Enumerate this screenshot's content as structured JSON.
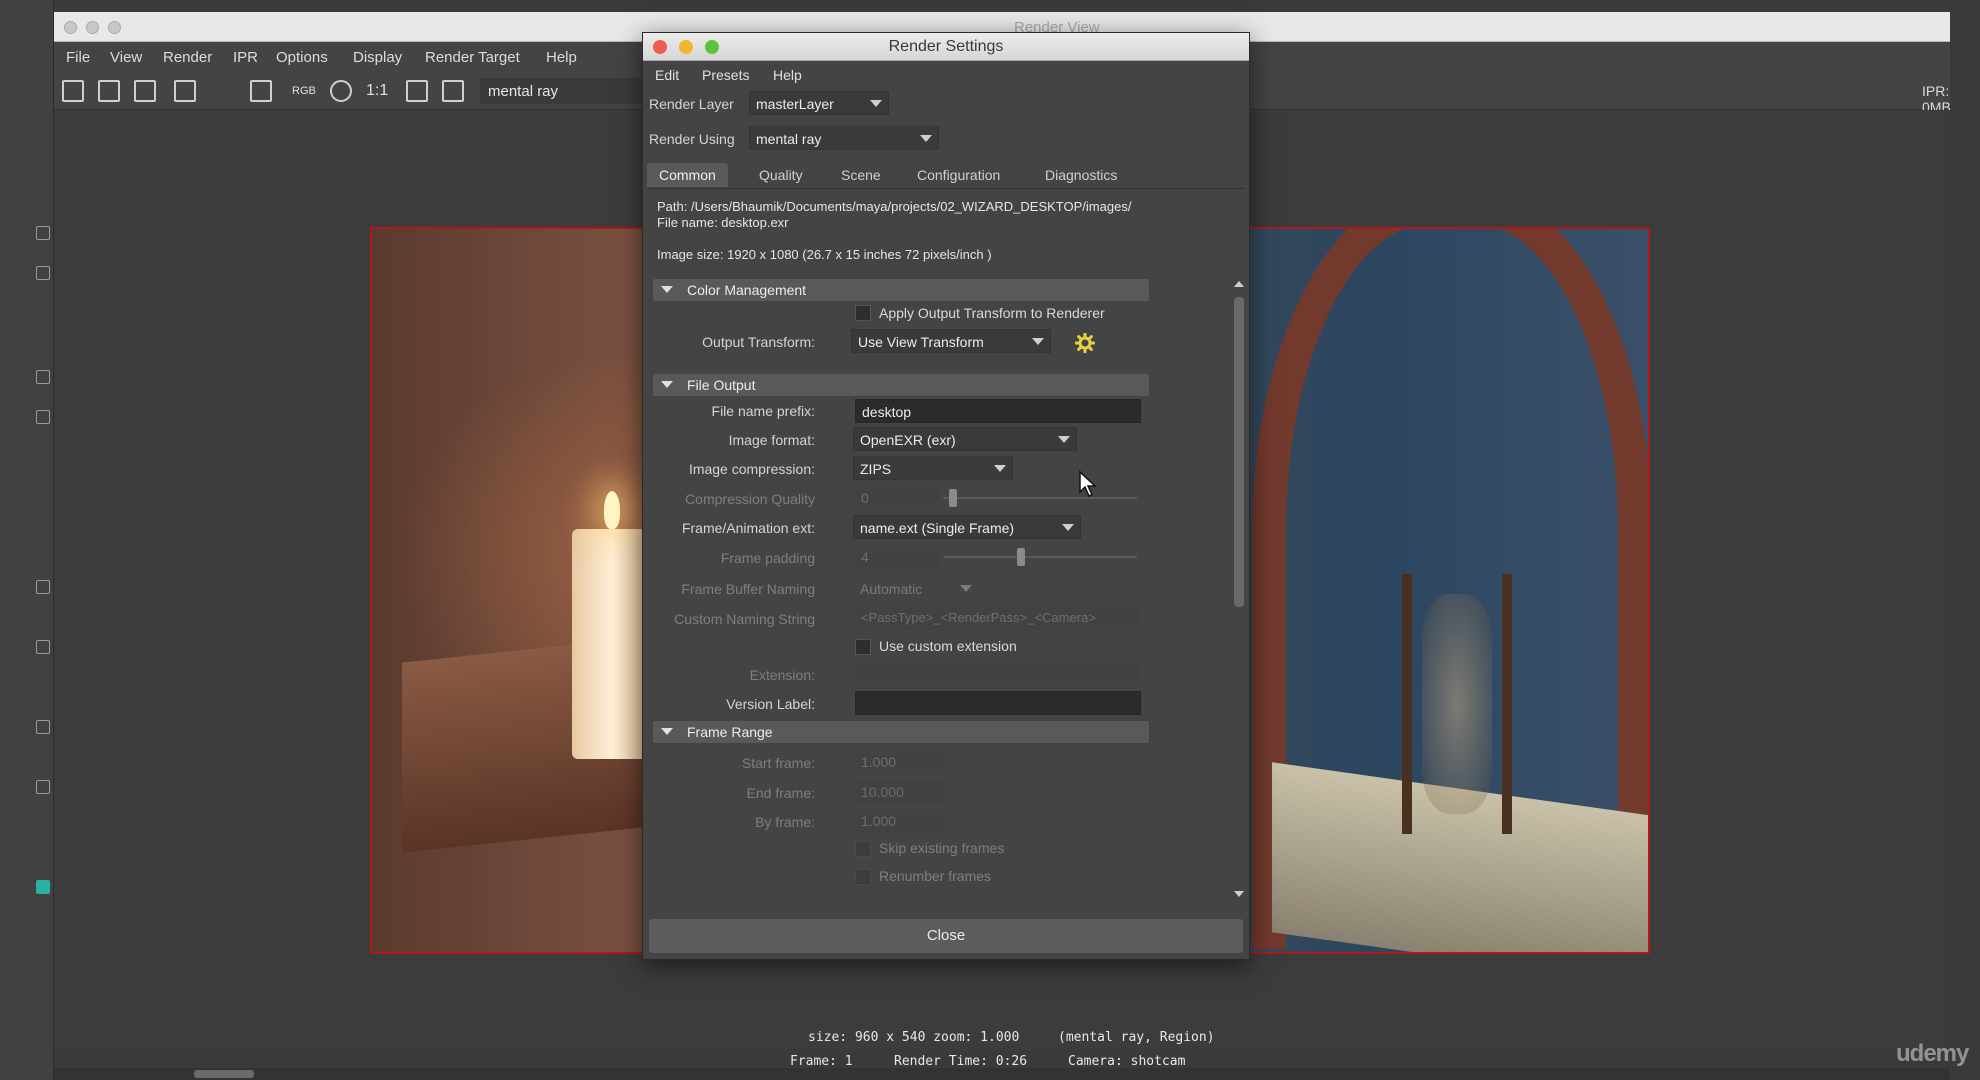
{
  "render_view": {
    "title": "Render View",
    "menu": [
      "File",
      "View",
      "Render",
      "IPR",
      "Options",
      "Display",
      "Render Target",
      "Help"
    ],
    "toolbar": {
      "rgb_label": "RGB",
      "zoom_label": "1:1",
      "renderer": "mental ray",
      "ipr_memory": "IPR: 0MB"
    },
    "status": {
      "size_zoom": "size: 960 x 540 zoom: 1.000",
      "renderer_region": "(mental ray, Region)",
      "frame": "Frame: 1",
      "render_time": "Render Time: 0:26",
      "camera": "Camera: shotcam"
    }
  },
  "watermark": "udemy",
  "render_settings": {
    "title": "Render Settings",
    "menu": [
      "Edit",
      "Presets",
      "Help"
    ],
    "render_layer_label": "Render Layer",
    "render_layer_value": "masterLayer",
    "render_using_label": "Render Using",
    "render_using_value": "mental ray",
    "tabs": [
      "Common",
      "Quality",
      "Scene",
      "Configuration",
      "Diagnostics"
    ],
    "active_tab": "Common",
    "path": "Path: /Users/Bhaumik/Documents/maya/projects/02_WIZARD_DESKTOP/images/",
    "file_name": "File name:  desktop.exr",
    "image_size": "Image size: 1920 x 1080 (26.7 x 15 inches 72 pixels/inch )",
    "color_management": {
      "header": "Color Management",
      "apply_output_transform": "Apply Output Transform to Renderer",
      "output_transform_label": "Output Transform:",
      "output_transform_value": "Use View Transform"
    },
    "file_output": {
      "header": "File Output",
      "file_name_prefix_label": "File name prefix:",
      "file_name_prefix_value": "desktop",
      "image_format_label": "Image format:",
      "image_format_value": "OpenEXR (exr)",
      "image_compression_label": "Image compression:",
      "image_compression_value": "ZIPS",
      "compression_quality_label": "Compression Quality",
      "compression_quality_value": "0",
      "frame_animation_ext_label": "Frame/Animation ext:",
      "frame_animation_ext_value": "name.ext (Single Frame)",
      "frame_padding_label": "Frame padding",
      "frame_padding_value": "4",
      "frame_buffer_naming_label": "Frame Buffer Naming",
      "frame_buffer_naming_value": "Automatic",
      "custom_naming_string_label": "Custom Naming String",
      "custom_naming_string_value": "<PassType>_<RenderPass>_<Camera>",
      "use_custom_extension": "Use custom extension",
      "extension_label": "Extension:",
      "extension_value": "",
      "version_label_label": "Version Label:",
      "version_label_value": ""
    },
    "frame_range": {
      "header": "Frame Range",
      "start_frame_label": "Start frame:",
      "start_frame_value": "1.000",
      "end_frame_label": "End frame:",
      "end_frame_value": "10.000",
      "by_frame_label": "By frame:",
      "by_frame_value": "1.000",
      "skip_existing": "Skip existing frames",
      "renumber": "Renumber frames"
    },
    "close_label": "Close"
  },
  "colors": {
    "close_red": "#ee5c52",
    "minimize_yellow": "#f2b630",
    "maximize_green": "#5ec33c",
    "region_border": "#b01818",
    "gear_yellow": "#e8d040"
  }
}
